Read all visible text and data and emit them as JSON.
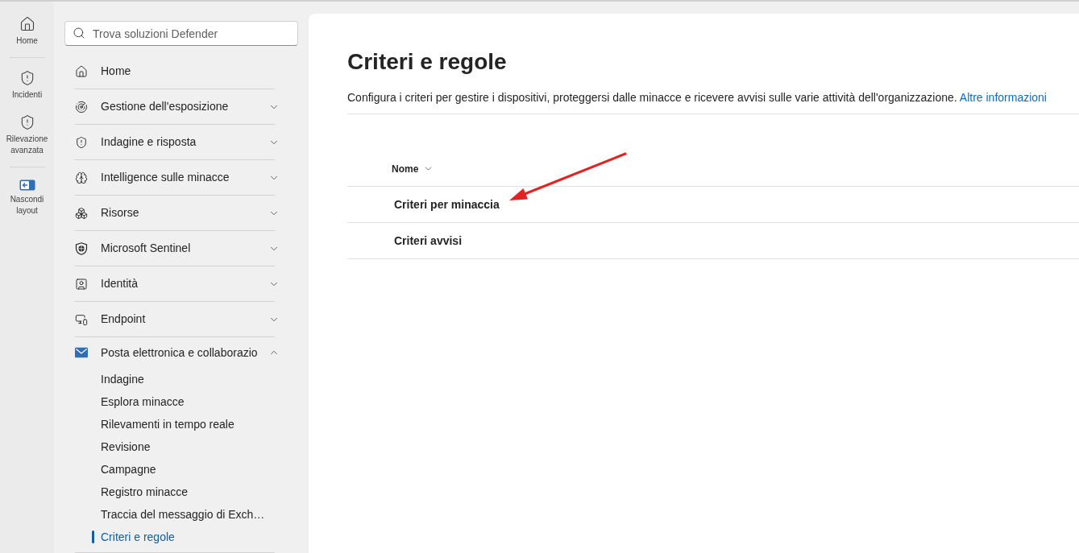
{
  "rail": {
    "groups": [
      {
        "items": [
          {
            "label": "Home"
          }
        ]
      },
      {
        "items": [
          {
            "label": "Incidenti"
          },
          {
            "label": "Rilevazione avanzata"
          }
        ]
      },
      {
        "items": [
          {
            "label": "Nascondi layout"
          }
        ]
      }
    ]
  },
  "sidebar": {
    "search": {
      "placeholder": "Trova soluzioni Defender"
    },
    "items": [
      {
        "kind": "link",
        "label": "Home"
      },
      {
        "kind": "group",
        "label": "Gestione dell'esposizione",
        "expanded": false
      },
      {
        "kind": "group",
        "label": "Indagine e risposta",
        "expanded": false
      },
      {
        "kind": "group",
        "label": "Intelligence sulle minacce",
        "expanded": false
      },
      {
        "kind": "group",
        "label": "Risorse",
        "expanded": false
      },
      {
        "kind": "group",
        "label": "Microsoft Sentinel",
        "expanded": false
      },
      {
        "kind": "group",
        "label": "Identità",
        "expanded": false
      },
      {
        "kind": "group",
        "label": "Endpoint",
        "expanded": false
      },
      {
        "kind": "group",
        "label": "Posta elettronica e collaborazio",
        "expanded": true,
        "children": [
          {
            "label": "Indagine",
            "selected": false
          },
          {
            "label": "Esplora minacce",
            "selected": false
          },
          {
            "label": "Rilevamenti in tempo reale",
            "selected": false
          },
          {
            "label": "Revisione",
            "selected": false
          },
          {
            "label": "Campagne",
            "selected": false
          },
          {
            "label": "Registro minacce",
            "selected": false
          },
          {
            "label": "Traccia del messaggio di Exch…",
            "selected": false
          },
          {
            "label": "Criteri e regole",
            "selected": true
          }
        ]
      }
    ]
  },
  "page": {
    "title": "Criteri e regole",
    "description": "Configura i criteri per gestire i dispositivi, proteggersi dalle minacce e ricevere avvisi sulle varie attività dell'organizzazione.",
    "link": "Altre informazioni"
  },
  "table": {
    "columns": [
      {
        "label": "Nome"
      }
    ],
    "rows": [
      {
        "name": "Criteri per minaccia"
      },
      {
        "name": "Criteri avvisi"
      }
    ]
  }
}
